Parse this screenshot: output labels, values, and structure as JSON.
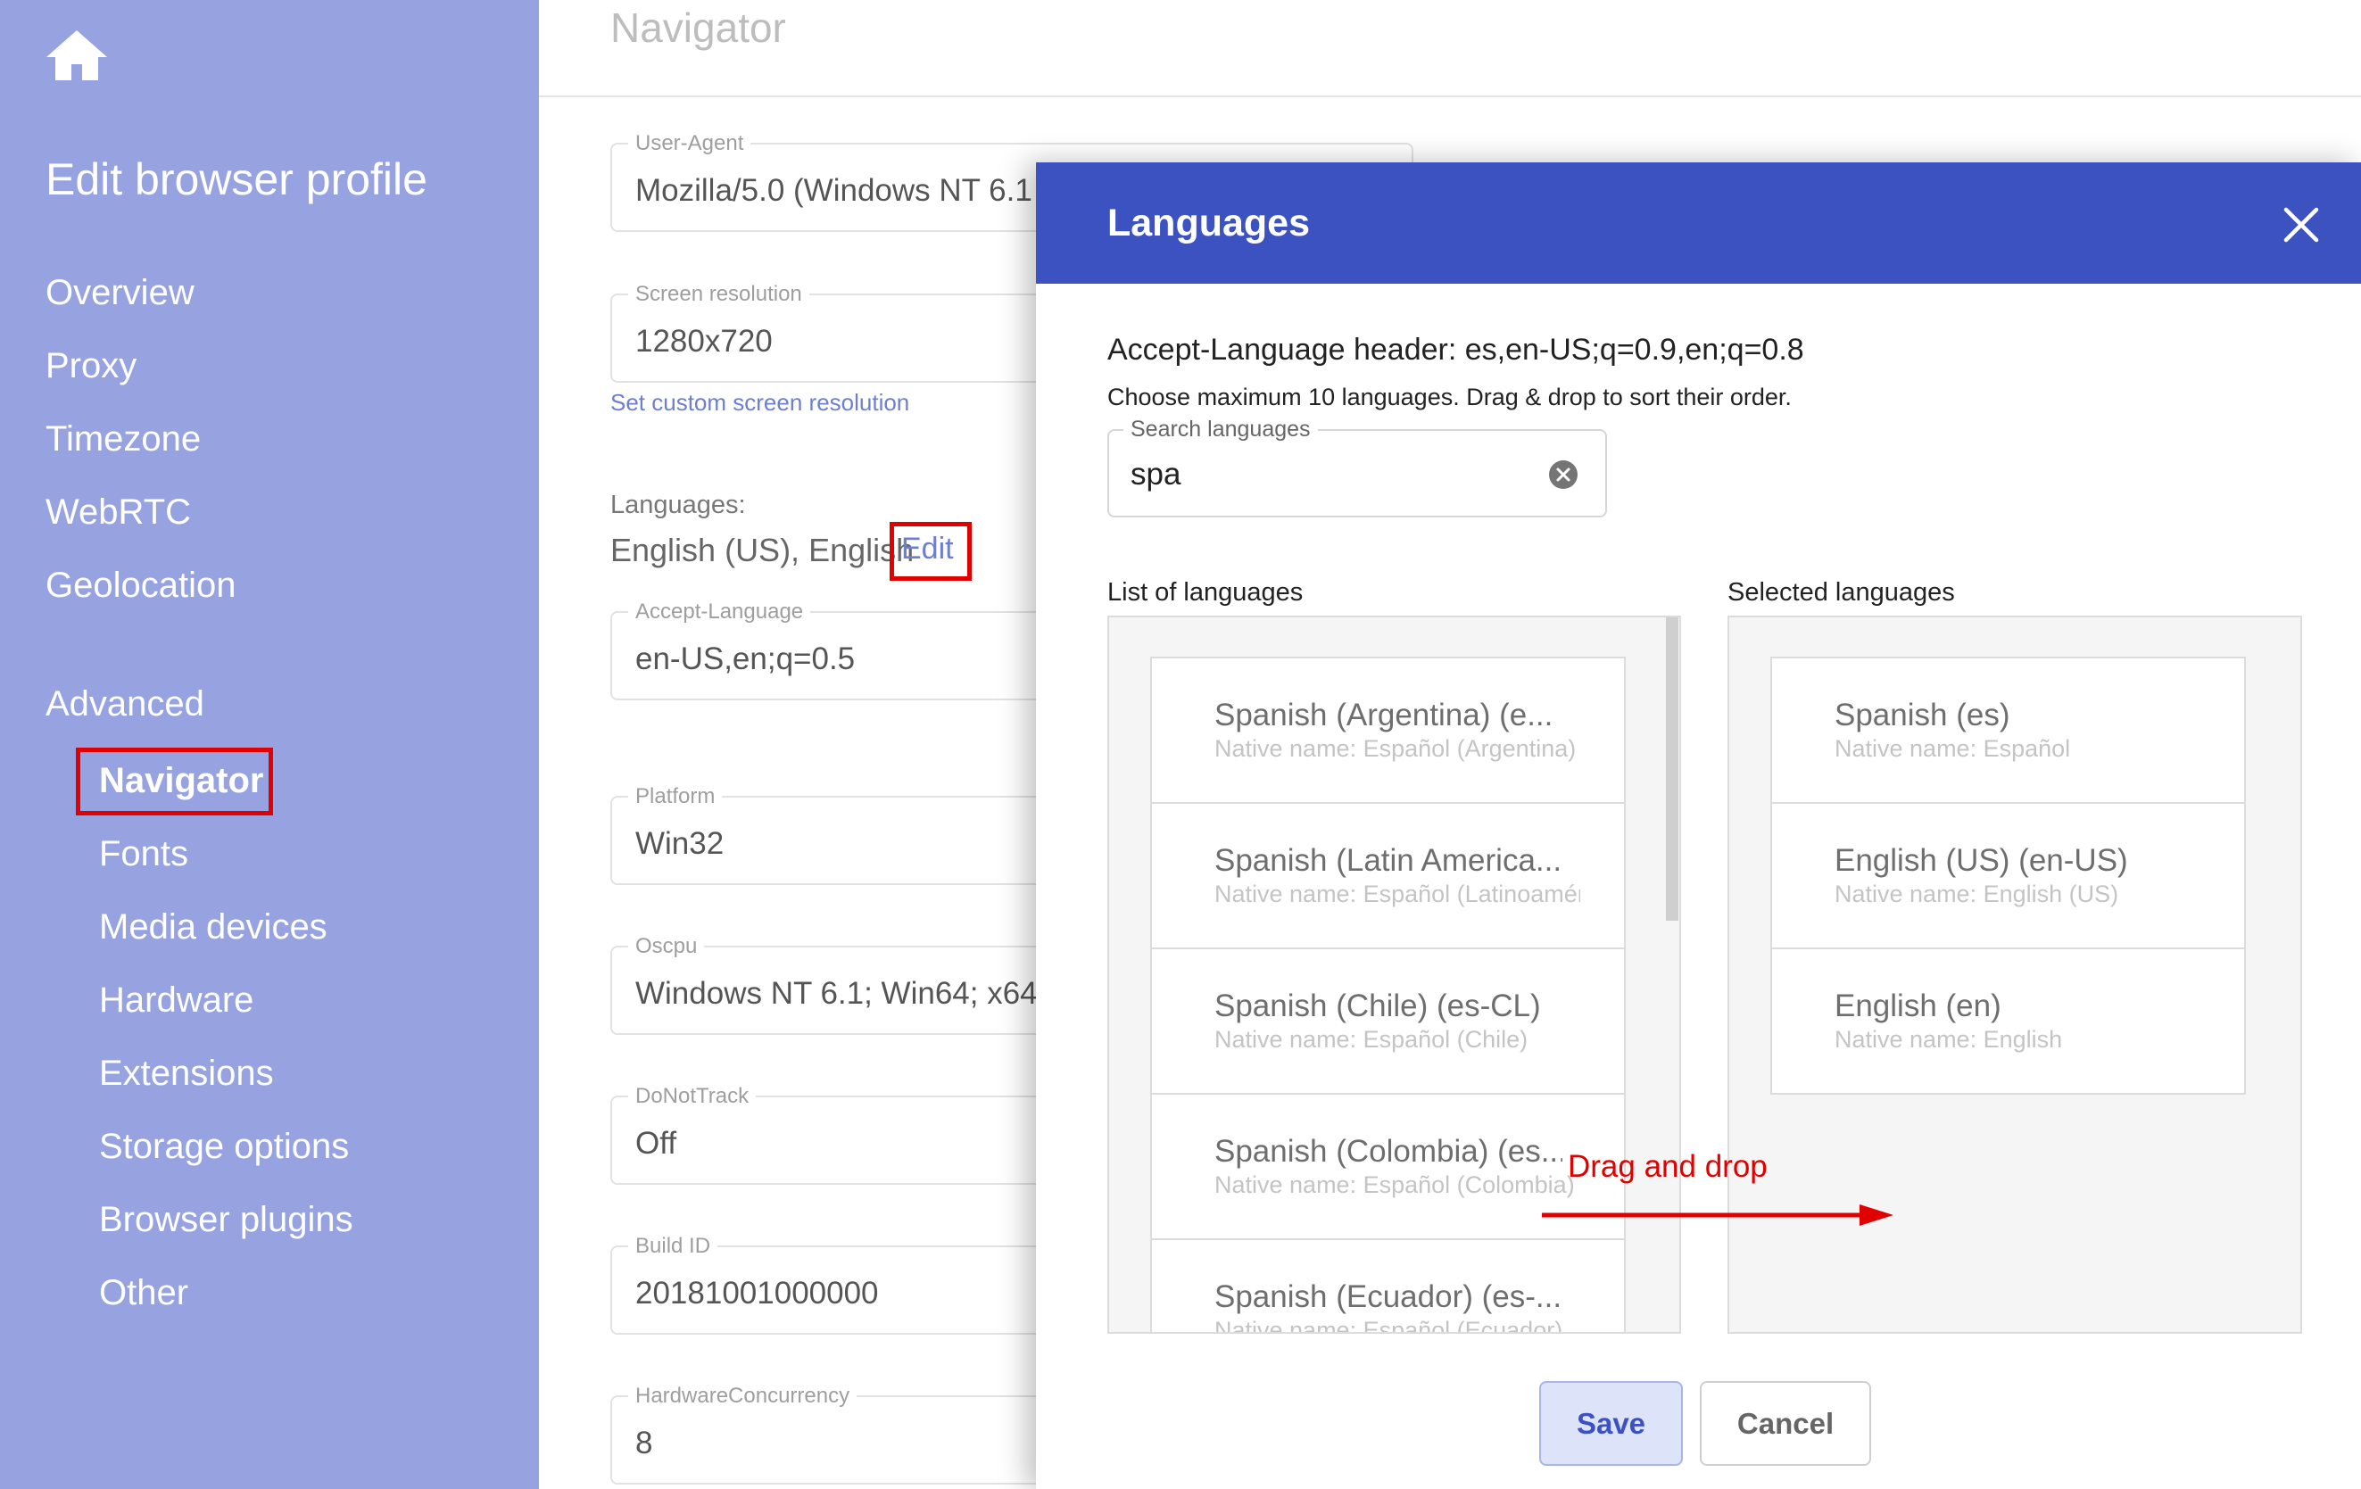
{
  "sidebar": {
    "home_icon": "home-icon",
    "title": "Edit browser profile",
    "items": [
      {
        "label": "Overview"
      },
      {
        "label": "Proxy"
      },
      {
        "label": "Timezone"
      },
      {
        "label": "WebRTC"
      },
      {
        "label": "Geolocation"
      },
      {
        "label": "Advanced"
      }
    ],
    "sub_items": [
      {
        "label": "Navigator",
        "active": true
      },
      {
        "label": "Fonts"
      },
      {
        "label": "Media devices"
      },
      {
        "label": "Hardware"
      },
      {
        "label": "Extensions"
      },
      {
        "label": "Storage options"
      },
      {
        "label": "Browser plugins"
      },
      {
        "label": "Other"
      }
    ]
  },
  "main": {
    "title": "Navigator",
    "user_agent": {
      "label": "User-Agent",
      "value": "Mozilla/5.0 (Windows NT 6.1"
    },
    "screen_resolution": {
      "label": "Screen resolution",
      "value": "1280x720"
    },
    "set_resolution_link": "Set custom screen resolution",
    "languages": {
      "label": "Languages:",
      "value": "English (US), English",
      "edit_label": "Edit"
    },
    "accept_language": {
      "label": "Accept-Language",
      "value": "en-US,en;q=0.5"
    },
    "platform": {
      "label": "Platform",
      "value": "Win32"
    },
    "oscpu": {
      "label": "Oscpu",
      "value": "Windows NT 6.1; Win64; x64"
    },
    "do_not_track": {
      "label": "DoNotTrack",
      "value": "Off"
    },
    "build_id": {
      "label": "Build ID",
      "value": "20181001000000"
    },
    "hardware_concurrency": {
      "label": "HardwareConcurrency",
      "value": "8"
    }
  },
  "modal": {
    "title": "Languages",
    "close_icon": "close-icon",
    "accept_header": "Accept-Language header: es,en-US;q=0.9,en;q=0.8",
    "instructions": "Choose maximum 10 languages. Drag & drop to sort their order.",
    "search": {
      "label": "Search languages",
      "value": "spa",
      "clear_icon": "clear-icon"
    },
    "list_heading": "List of languages",
    "selected_heading": "Selected languages",
    "available": [
      {
        "name": "Spanish (Argentina) (e...",
        "native": "Native name: Español (Argentina)"
      },
      {
        "name": "Spanish (Latin America...",
        "native": "Native name: Español (Latinoamérica)"
      },
      {
        "name": "Spanish (Chile) (es-CL)",
        "native": "Native name: Español (Chile)"
      },
      {
        "name": "Spanish (Colombia) (es...",
        "native": "Native name: Español (Colombia)"
      },
      {
        "name": "Spanish (Ecuador) (es-...",
        "native": "Native name: Español (Ecuador)"
      }
    ],
    "selected": [
      {
        "name": "Spanish (es)",
        "native": "Native name: Español"
      },
      {
        "name": "English (US) (en-US)",
        "native": "Native name: English (US)"
      },
      {
        "name": "English (en)",
        "native": "Native name: English"
      }
    ],
    "annotation": "Drag and drop",
    "save_label": "Save",
    "cancel_label": "Cancel"
  },
  "colors": {
    "sidebar_bg": "#97a3e0",
    "modal_header": "#3c52c1",
    "link": "#6c7fd0",
    "highlight": "#e10000"
  }
}
